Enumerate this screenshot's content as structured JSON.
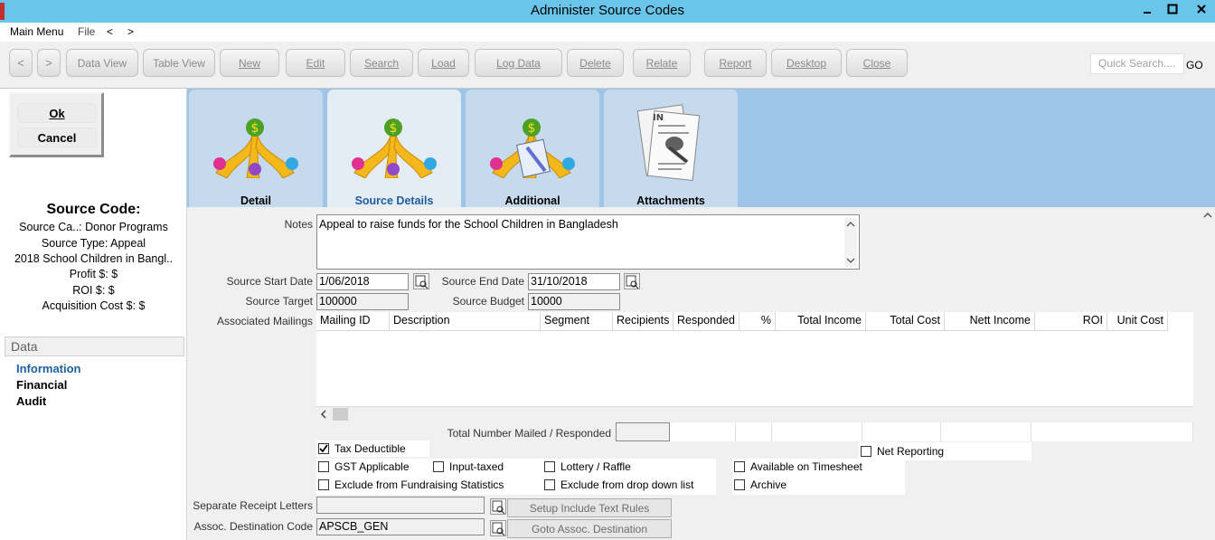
{
  "window": {
    "title": "Administer Source Codes"
  },
  "menu": {
    "main": "Main Menu",
    "file": "File",
    "back": "<",
    "forward": ">"
  },
  "toolbar": {
    "back": "<",
    "forward": ">",
    "data_view": "Data View",
    "table_view": "Table View",
    "new": "New",
    "edit": "Edit",
    "search": "Search",
    "load": "Load",
    "log_data": "Log Data",
    "delete": "Delete",
    "relate": "Relate",
    "report": "Report",
    "desktop": "Desktop",
    "close": "Close",
    "quick_search_placeholder": "Quick Search....",
    "go": "GO"
  },
  "left": {
    "ok": "Ok",
    "cancel": "Cancel",
    "source_code_heading": "Source Code:",
    "lines": [
      "Source Ca..: Donor Programs",
      "Source Type: Appeal",
      "2018 School Children in Bangl..",
      "Profit $: $",
      "ROI $: $",
      "Acquisition Cost $: $"
    ],
    "data_header": "Data",
    "links": [
      "Information",
      "Financial",
      "Audit"
    ]
  },
  "tabs": [
    "Detail",
    "Source Details",
    "Additional",
    "Attachments"
  ],
  "form": {
    "notes_label": "Notes",
    "notes": "Appeal to raise funds for the School Children in Bangladesh",
    "start_date_label": "Source Start Date",
    "start_date": "1/06/2018",
    "end_date_label": "Source End Date",
    "end_date": "31/10/2018",
    "target_label": "Source Target",
    "target": "100000",
    "budget_label": "Source Budget",
    "budget": "10000",
    "mailings_label": "Associated Mailings",
    "columns": [
      "Mailing ID",
      "Description",
      "Segment",
      "Recipients",
      "Responded",
      "%",
      "Total Income",
      "Total Cost",
      "Nett Income",
      "ROI",
      "Unit Cost"
    ],
    "total_label": "Total Number Mailed / Responded",
    "checkboxes": {
      "tax_deductible": "Tax Deductible",
      "net_reporting": "Net Reporting",
      "gst_applicable": "GST Applicable",
      "input_taxed": "Input-taxed",
      "lottery_raffle": "Lottery / Raffle",
      "available_timesheet": "Available on Timesheet",
      "exclude_stats": "Exclude from Fundraising Statistics",
      "exclude_dropdown": "Exclude from drop down list",
      "archive": "Archive"
    },
    "receipt_letters_label": "Separate Receipt Letters",
    "setup_rules": "Setup Include Text Rules",
    "dest_code_label": "Assoc. Destination Code",
    "dest_code": "APSCB_GEN",
    "goto_dest": "Goto Assoc. Destination"
  }
}
